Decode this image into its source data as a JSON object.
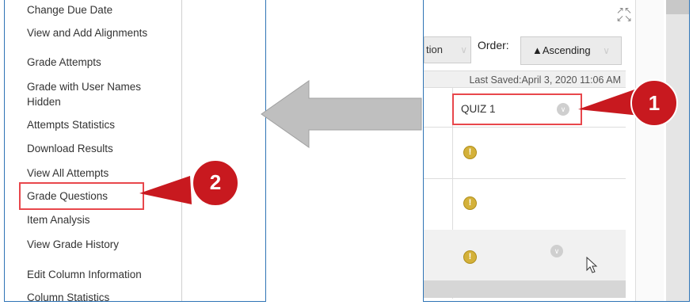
{
  "left_menu": {
    "items": [
      {
        "label": "Change Due Date"
      },
      {
        "label": "View and Add Alignments"
      },
      {
        "label": "Grade Attempts"
      },
      {
        "label": "Grade with User Names Hidden"
      },
      {
        "label": "Attempts Statistics"
      },
      {
        "label": "Download Results"
      },
      {
        "label": "View All Attempts"
      },
      {
        "label": "Grade Questions"
      },
      {
        "label": "Item Analysis"
      },
      {
        "label": "View Grade History"
      },
      {
        "label": "Edit Column Information"
      },
      {
        "label": "Column Statistics"
      }
    ],
    "highlighted_item": "Grade Questions"
  },
  "grade_center": {
    "sort_field_partial": "tion",
    "order_label": "Order:",
    "order_value": "▲Ascending",
    "last_saved": "Last Saved:April 3, 2020 11:06 AM",
    "column_header": "QUIZ 1",
    "row_icon": "!"
  },
  "callouts": {
    "one": "1",
    "two": "2"
  },
  "colors": {
    "highlight": "#e8474c",
    "callout_red": "#c8191f",
    "panel_border": "#2f74b5",
    "arrow_fill": "#bfbfbf",
    "warning": "#d4b13a"
  }
}
